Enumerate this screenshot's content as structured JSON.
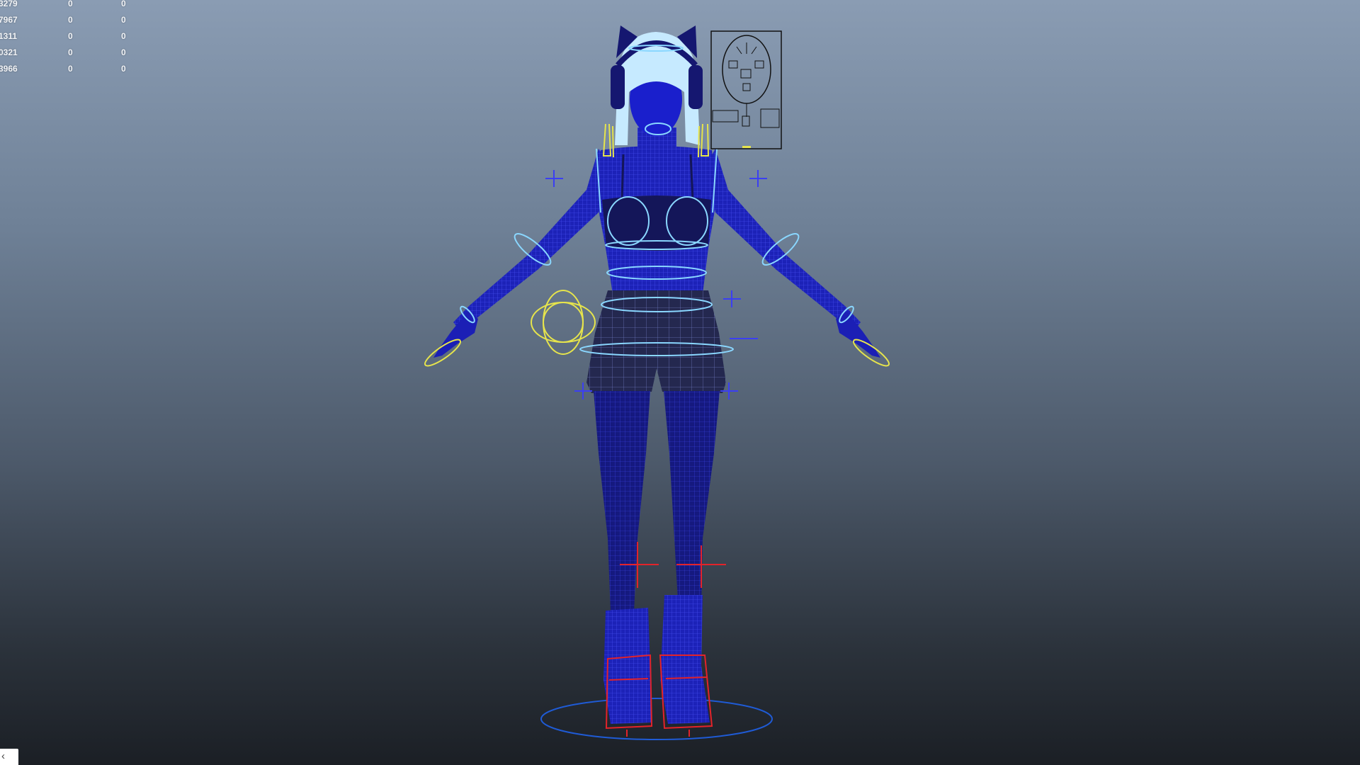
{
  "hud": {
    "rows": [
      {
        "c0": "3279",
        "c1": "0",
        "c2": "0"
      },
      {
        "c0": "7967",
        "c1": "0",
        "c2": "0"
      },
      {
        "c0": "1311",
        "c1": "0",
        "c2": "0"
      },
      {
        "c0": "0321",
        "c1": "0",
        "c2": "0"
      },
      {
        "c0": "3966",
        "c1": "0",
        "c2": "0"
      }
    ]
  },
  "corner_tab": {
    "icon": "chevron-left-icon",
    "glyph": "‹"
  },
  "colors": {
    "mesh_blue": "#1a1fb8",
    "control_cyan": "#7fd3ff",
    "control_yellow": "#e4e24a",
    "control_red": "#e3232a",
    "locator_blue": "#3c3cf0",
    "hair": "#bfe7ff"
  }
}
